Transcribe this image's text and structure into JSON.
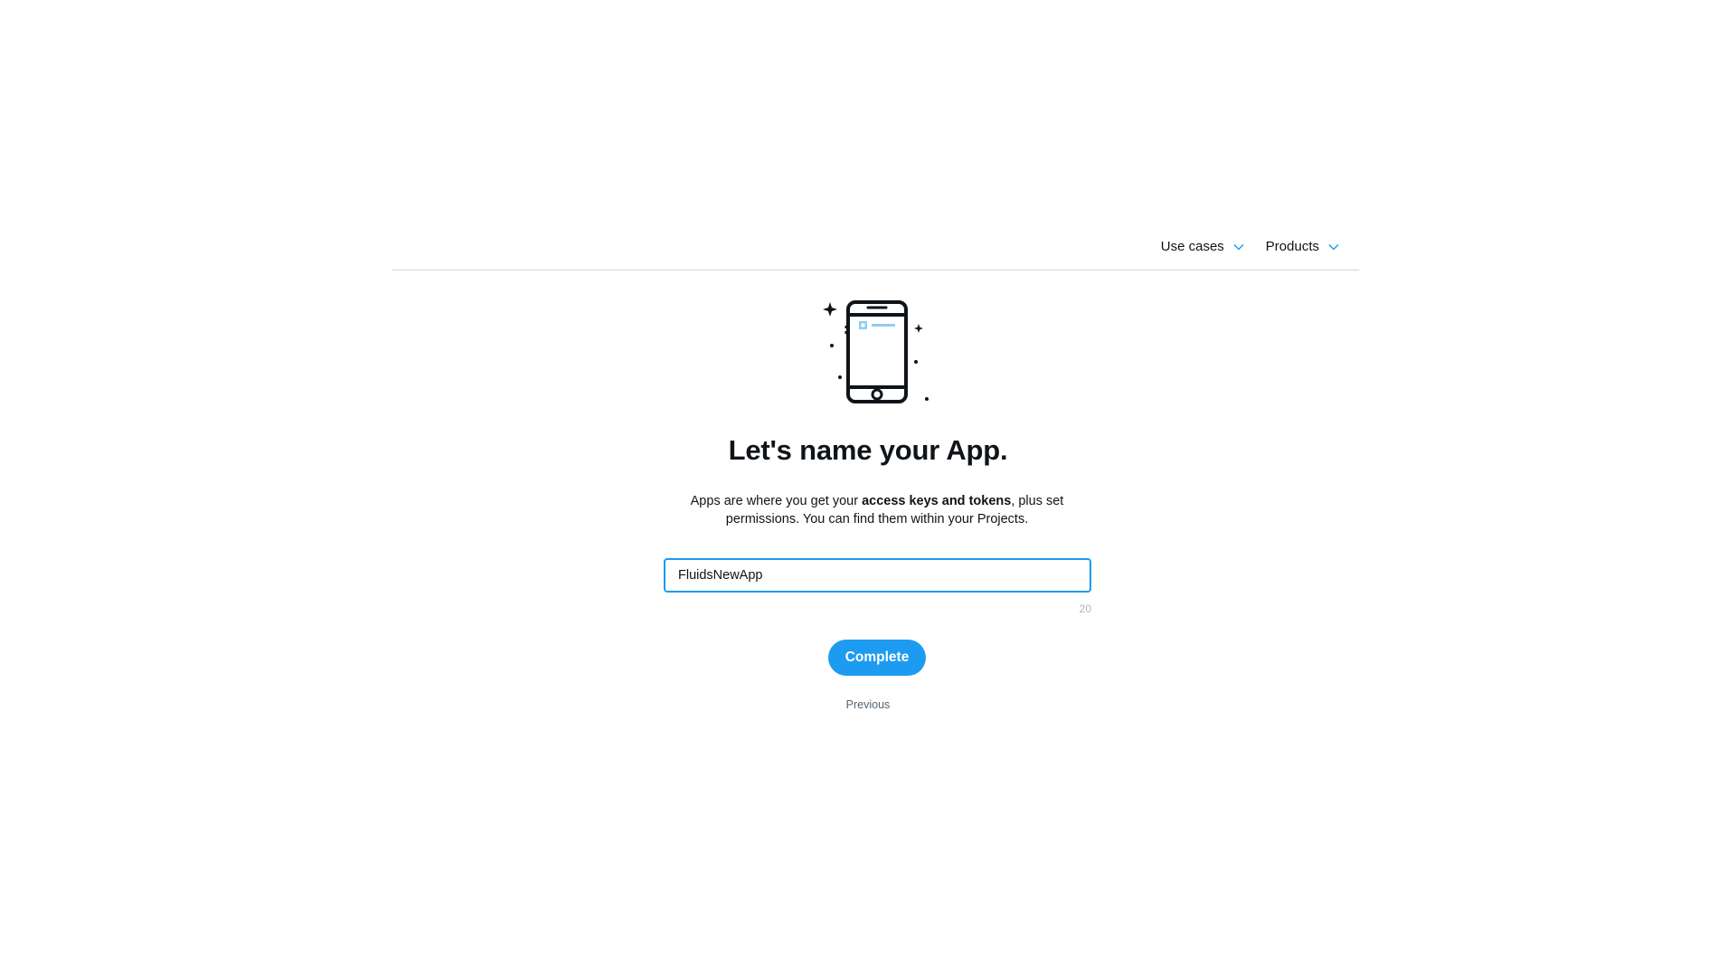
{
  "nav": {
    "items": [
      {
        "label": "Use cases",
        "icon": "chevron-down-icon"
      },
      {
        "label": "Products",
        "icon": "chevron-down-icon"
      }
    ]
  },
  "hero": {
    "icon": "smartphone-sparkle-icon"
  },
  "main": {
    "title": "Let's name your App.",
    "description_part1": "Apps are where you get your ",
    "description_bold": "access keys and tokens",
    "description_part2": ", plus set permissions. You can find them within your Projects.",
    "app_name_value": "FluidsNewApp",
    "char_counter": "20",
    "complete_label": "Complete",
    "previous_label": "Previous"
  },
  "colors": {
    "accent": "#1d9bf0",
    "text": "#0f1419",
    "muted": "#536471"
  }
}
